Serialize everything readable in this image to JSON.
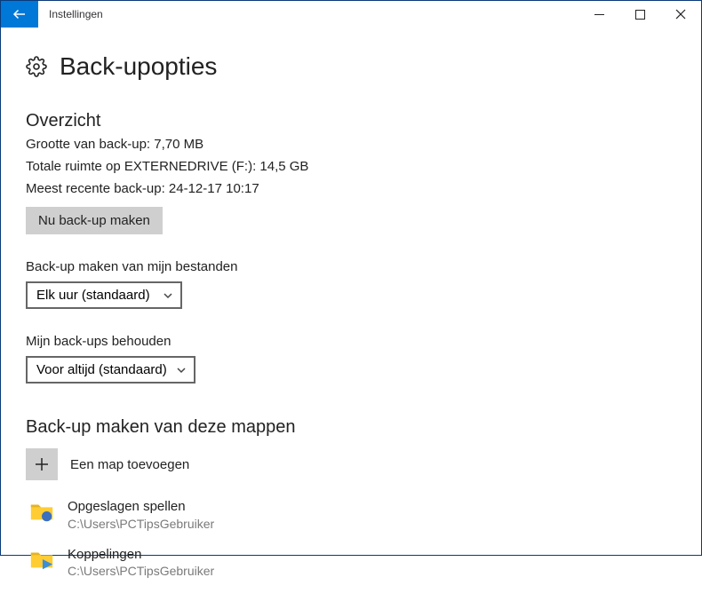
{
  "titlebar": {
    "app_name": "Instellingen"
  },
  "page": {
    "title": "Back-upopties"
  },
  "overview": {
    "heading": "Overzicht",
    "size_line": "Grootte van back-up: 7,70 MB",
    "space_line": "Totale ruimte op EXTERNEDRIVE (F:): 14,5 GB",
    "last_line": "Meest recente back-up: 24-12-17 10:17",
    "backup_now_label": "Nu back-up maken"
  },
  "frequency": {
    "label": "Back-up maken van mijn bestanden",
    "value": "Elk uur (standaard)"
  },
  "retention": {
    "label": "Mijn back-ups behouden",
    "value": "Voor altijd (standaard)"
  },
  "folders": {
    "heading": "Back-up maken van deze mappen",
    "add_label": "Een map toevoegen",
    "items": [
      {
        "name": "Opgeslagen spellen",
        "path": "C:\\Users\\PCTipsGebruiker"
      },
      {
        "name": "Koppelingen",
        "path": "C:\\Users\\PCTipsGebruiker"
      }
    ]
  }
}
